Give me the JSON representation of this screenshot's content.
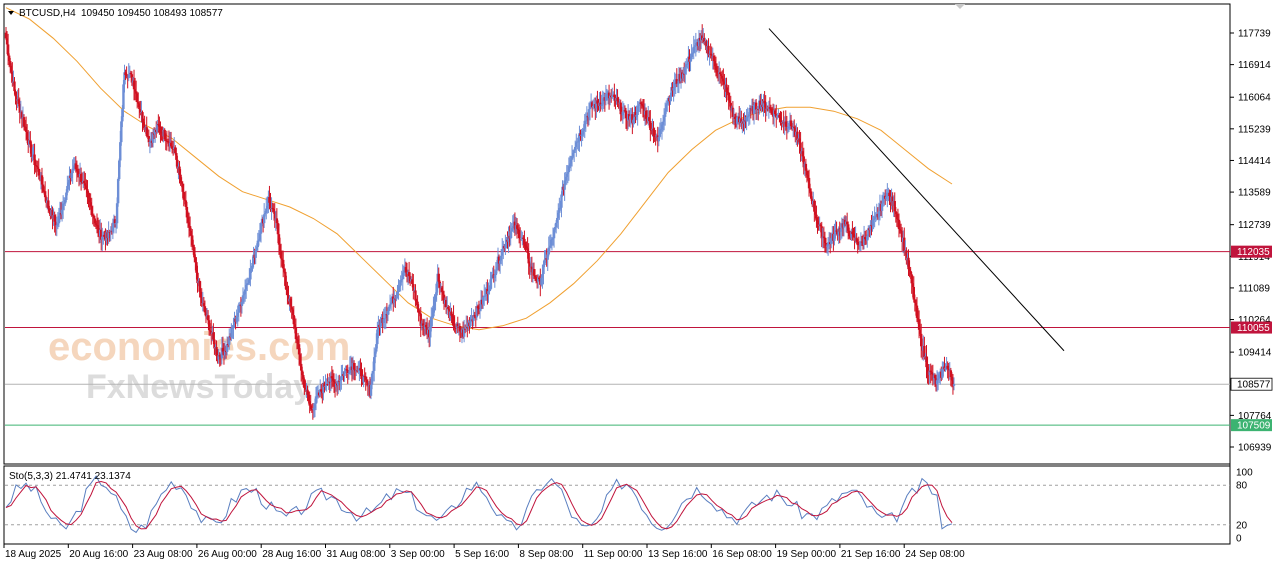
{
  "chart_data": [
    {
      "type": "candlestick",
      "symbol_label": "BTCUSD,H4",
      "ohlc_label": "109450 109450 108493 108577",
      "price_axis_ticks": [
        117739,
        116914,
        116064,
        115239,
        114414,
        113589,
        112739,
        111914,
        111089,
        110264,
        109414,
        107764,
        106939
      ],
      "x_ticks": [
        "18 Aug 2025",
        "20 Aug 16:00",
        "23 Aug 08:00",
        "26 Aug 00:00",
        "28 Aug 16:00",
        "31 Aug 08:00",
        "3 Sep 00:00",
        "5 Sep 16:00",
        "8 Sep 08:00",
        "11 Sep 00:00",
        "13 Sep 16:00",
        "16 Sep 08:00",
        "19 Sep 00:00",
        "21 Sep 16:00",
        "24 Sep 08:00"
      ],
      "ylim": [
        106939,
        117739
      ],
      "levels": [
        {
          "value": 112035,
          "label": "112035",
          "color": "#c0143c"
        },
        {
          "value": 110055,
          "label": "110055",
          "color": "#c0143c"
        },
        {
          "value": 108577,
          "label": "108577",
          "color": "#ffffff"
        },
        {
          "value": 107509,
          "label": "107509",
          "color": "#3cb371"
        }
      ],
      "colors": {
        "bull": "#6d8ed6",
        "bear": "#d01020",
        "ma": "#f0a030",
        "trendline": "#000000"
      },
      "close_path": [
        117600,
        116200,
        115500,
        114600,
        114000,
        113200,
        112700,
        113500,
        114300,
        113900,
        113200,
        112500,
        112400,
        112900,
        116800,
        116500,
        115600,
        114900,
        115300,
        115000,
        114600,
        113400,
        112200,
        110800,
        110100,
        109300,
        109500,
        110200,
        110900,
        111600,
        112600,
        113400,
        112700,
        111200,
        110200,
        108800,
        107900,
        108300,
        108700,
        108600,
        108900,
        109100,
        108800,
        108400,
        110100,
        110500,
        110900,
        111600,
        111200,
        110200,
        109900,
        111400,
        110600,
        110100,
        109900,
        110300,
        110600,
        111100,
        111700,
        112300,
        112700,
        112400,
        111600,
        111200,
        112000,
        112700,
        113900,
        114700,
        115200,
        115800,
        115900,
        116100,
        116000,
        115600,
        115500,
        115900,
        115400,
        114900,
        115900,
        116400,
        116700,
        117200,
        117600,
        117300,
        116800,
        116300,
        115500,
        115400,
        115700,
        115900,
        115800,
        115600,
        115400,
        115300,
        114600,
        113600,
        112700,
        112200,
        112500,
        112800,
        112400,
        112200,
        112600,
        113000,
        113600,
        113200,
        112300,
        111200,
        109800,
        108900,
        108600,
        109100,
        108577
      ],
      "ma_path": [
        118400,
        118100,
        117600,
        117000,
        116300,
        115700,
        115300,
        115000,
        114500,
        114000,
        113600,
        113400,
        113200,
        112900,
        112500,
        111900,
        111300,
        110700,
        110300,
        110100,
        110000,
        110100,
        110300,
        110700,
        111200,
        111800,
        112500,
        113300,
        114100,
        114700,
        115200,
        115500,
        115700,
        115800,
        115800,
        115700,
        115500,
        115200,
        114700,
        114200,
        113800
      ],
      "trendline": {
        "from": [
          117750,
          "16 Sep 08:00"
        ],
        "to": [
          109450,
          "27 Sep"
        ]
      }
    },
    {
      "type": "line",
      "label": "Sto(5,3,3) 21.4741 23.1374",
      "ylim": [
        0,
        100
      ],
      "y_ticks": [
        100,
        80,
        20,
        0
      ],
      "levels": [
        80,
        20
      ],
      "series": [
        {
          "color": "#5a7fc0"
        },
        {
          "color": "#c0143c"
        }
      ]
    }
  ],
  "watermark": {
    "line1": "economies.com",
    "line2": "FxNewsToday"
  }
}
